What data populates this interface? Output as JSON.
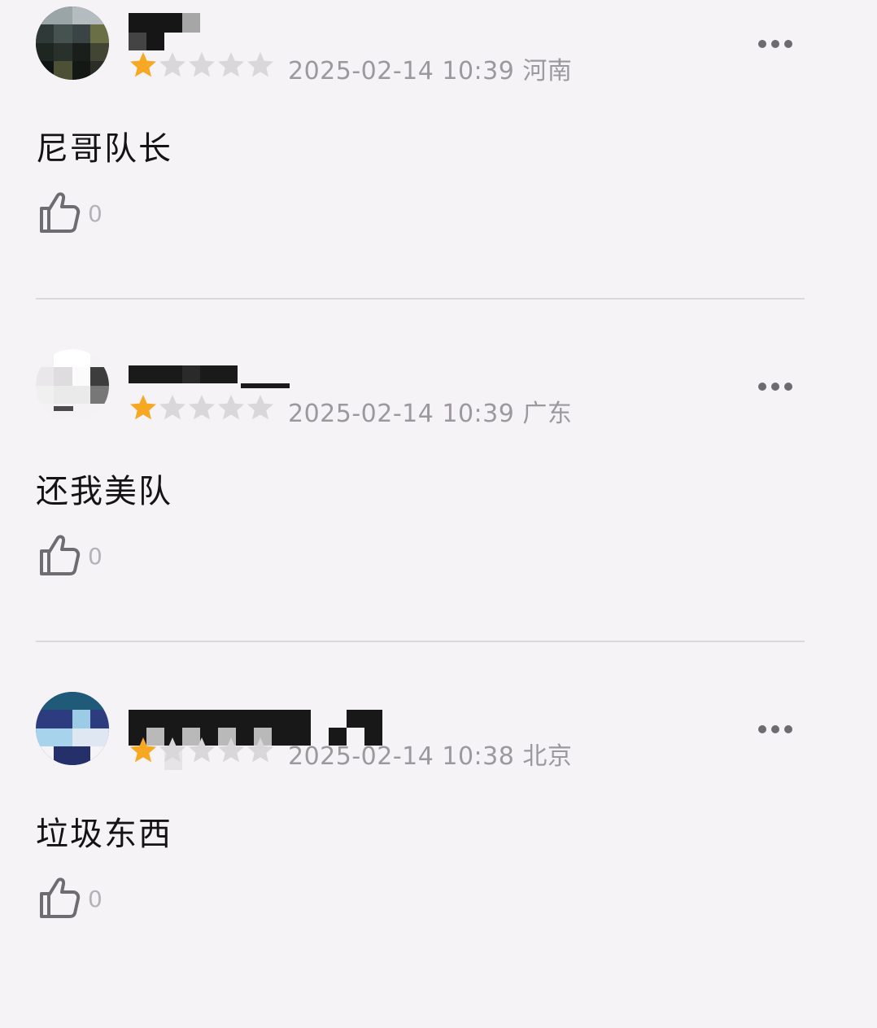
{
  "reviews": [
    {
      "rating": 1,
      "max_rating": 5,
      "datetime": "2025-02-14 10:39",
      "location": "河南",
      "content": "尼哥队长",
      "likes": "0",
      "star_color": "#f7a823",
      "star_empty_color": "#d9d7da"
    },
    {
      "rating": 1,
      "max_rating": 5,
      "datetime": "2025-02-14 10:39",
      "location": "广东",
      "content": "还我美队",
      "likes": "0",
      "star_color": "#f7a823",
      "star_empty_color": "#d9d7da"
    },
    {
      "rating": 1,
      "max_rating": 5,
      "datetime": "2025-02-14 10:38",
      "location": "北京",
      "content": "垃圾东西",
      "likes": "0",
      "star_color": "#f7a823",
      "star_empty_color": "#d9d7da"
    }
  ],
  "icons": {
    "like": "thumbs-up-icon",
    "more": "more-options-icon",
    "star": "star-icon"
  }
}
